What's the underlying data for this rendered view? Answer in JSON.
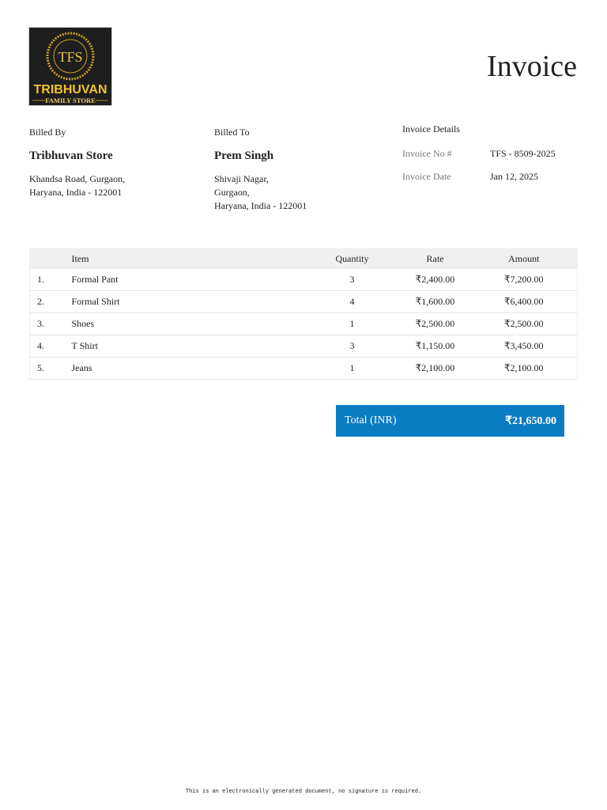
{
  "logo": {
    "monogram": "TFS",
    "brand": "TRIBHUVAN",
    "tagline": "FAMILY STORE"
  },
  "title": "Invoice",
  "billed_by": {
    "label": "Billed By",
    "name": "Tribhuvan Store",
    "address": [
      "Khandsa Road, Gurgaon,",
      "Haryana, India - 122001"
    ]
  },
  "billed_to": {
    "label": "Billed To",
    "name": "Prem Singh",
    "address": [
      "Shivaji Nagar,",
      "Gurgaon,",
      "Haryana, India - 122001"
    ]
  },
  "details": {
    "label": "Invoice Details",
    "no_label": "Invoice No #",
    "no": "TFS - 8509-2025",
    "date_label": "Invoice Date",
    "date": "Jan 12, 2025"
  },
  "table": {
    "headers": [
      "",
      "Item",
      "Quantity",
      "Rate",
      "Amount"
    ],
    "rows": [
      [
        "1.",
        "Formal Pant",
        "3",
        "₹2,400.00",
        "₹7,200.00"
      ],
      [
        "2.",
        "Formal Shirt",
        "4",
        "₹1,600.00",
        "₹6,400.00"
      ],
      [
        "3.",
        "Shoes",
        "1",
        "₹2,500.00",
        "₹2,500.00"
      ],
      [
        "4.",
        "T Shirt",
        "3",
        "₹1,150.00",
        "₹3,450.00"
      ],
      [
        "5.",
        "Jeans",
        "1",
        "₹2,100.00",
        "₹2,100.00"
      ]
    ]
  },
  "total": {
    "label": "Total (INR)",
    "value": "₹21,650.00"
  },
  "footer": "This is an electronically generated document, no signature is required."
}
